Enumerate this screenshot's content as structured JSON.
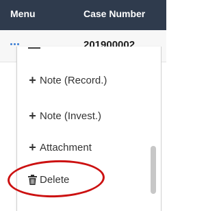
{
  "header": {
    "menu_label": "Menu",
    "case_number_label": "Case Number"
  },
  "row": {
    "actions_icon": "ellipsis-icon",
    "case_number": "201900002"
  },
  "menu": {
    "items": [
      {
        "label": "Note (Record.)",
        "icon": "plus-icon"
      },
      {
        "label": "Note (Invest.)",
        "icon": "plus-icon"
      },
      {
        "label": "Attachment",
        "icon": "plus-icon"
      },
      {
        "label": "Delete",
        "icon": "trash-icon"
      }
    ]
  },
  "colors": {
    "header_bg": "#2f3b4d",
    "accent": "#3d7fd4",
    "highlight": "#cc1111"
  }
}
